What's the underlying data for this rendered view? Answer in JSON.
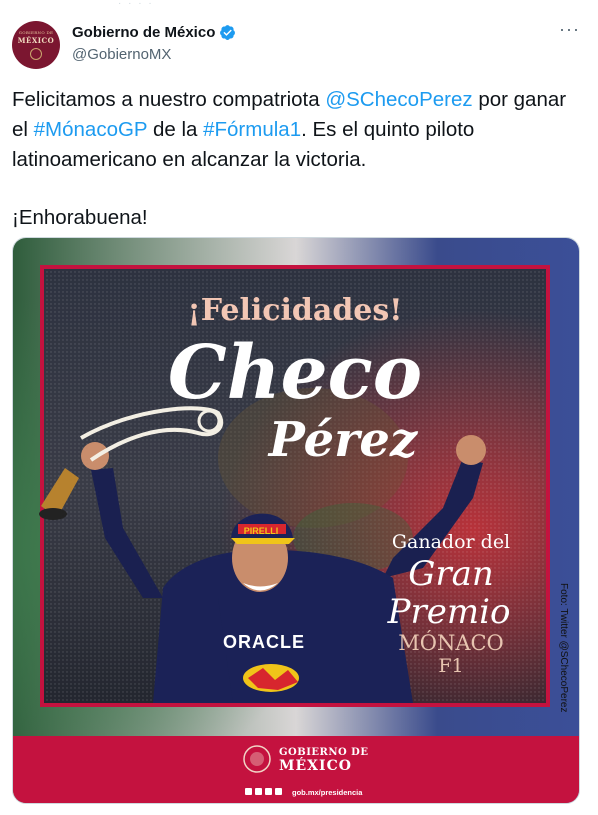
{
  "tweet": {
    "display_name": "Gobierno de México",
    "handle": "@GobiernoMX",
    "verified": true,
    "more_icon": "ellipsis-icon",
    "avatar": {
      "line1": "GOBIERNO DE",
      "line2": "MÉXICO"
    },
    "text": {
      "part1": "Felicitamos a nuestro compatriota ",
      "mention": "@SChecoPerez",
      "part2": " por ganar el ",
      "hashtag1": "#MónacoGP",
      "part3": " de la ",
      "hashtag2": "#Fórmula1",
      "part4": ". Es el quinto piloto latinoamericano en alcanzar la victoria.",
      "line2": "¡Enhorabuena!"
    },
    "link_color": "#1d9bf0"
  },
  "poster": {
    "headline": "¡Felicidades!",
    "name_first": "Checo",
    "name_last": "Pérez",
    "caption_line1": "Ganador del",
    "caption_line2": "Gran",
    "caption_line3": "Premio",
    "caption_line4": "MÓNACO",
    "caption_line5": "F1",
    "photo_credit": "Foto: Twitter @SChecoPerez",
    "suit_text": "ORACLE",
    "cap_text": "PIRELLI",
    "footer_logo_line1": "GOBIERNO DE",
    "footer_logo_line2": "MÉXICO",
    "footer_url": "gob.mx/presidencia",
    "frame_color": "#c4123f",
    "footer_color": "#c4123f"
  }
}
